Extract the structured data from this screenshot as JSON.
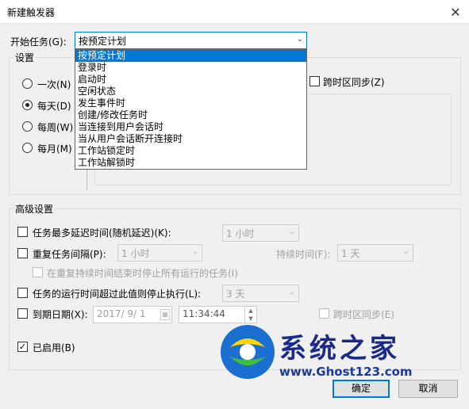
{
  "window": {
    "title": "新建触发器",
    "close_glyph": "✕"
  },
  "start_task": {
    "label": "开始任务(G):",
    "selected": "按预定计划",
    "options": [
      "按预定计划",
      "登录时",
      "启动时",
      "空闲状态",
      "发生事件时",
      "创建/修改任务时",
      "当连接到用户会话时",
      "当从用户会话断开连接时",
      "工作站锁定时",
      "工作站解锁时"
    ]
  },
  "settings": {
    "legend": "设置",
    "radios": [
      "一次(N)",
      "每天(D)",
      "每周(W)",
      "每月(M)"
    ],
    "selected_radio": "每天(D)",
    "sync_timezone": "跨时区同步(Z)"
  },
  "advanced": {
    "legend": "高级设置",
    "delay_label": "任务最多延迟时间(随机延迟)(K):",
    "delay_value": "1 小时",
    "repeat_label": "重复任务间隔(P):",
    "repeat_value": "1 小时",
    "duration_label": "持续时间(F):",
    "duration_value": "1 天",
    "stop_all_label": "在重复持续时间结束时停止所有运行的任务(I)",
    "stop_long_label": "任务的运行时间超过此值则停止执行(L):",
    "stop_long_value": "3 天",
    "expire_label": "到期日期(X):",
    "expire_date": "2017/ 9/ 1",
    "expire_time": "11:34:44",
    "expire_sync": "跨时区同步(E)",
    "enabled_label": "已启用(B)",
    "enabled_check": "✓"
  },
  "buttons": {
    "ok": "确定",
    "cancel": "取消"
  },
  "watermark": {
    "brand": "系统之家",
    "url": "www.Ghost123.com"
  }
}
